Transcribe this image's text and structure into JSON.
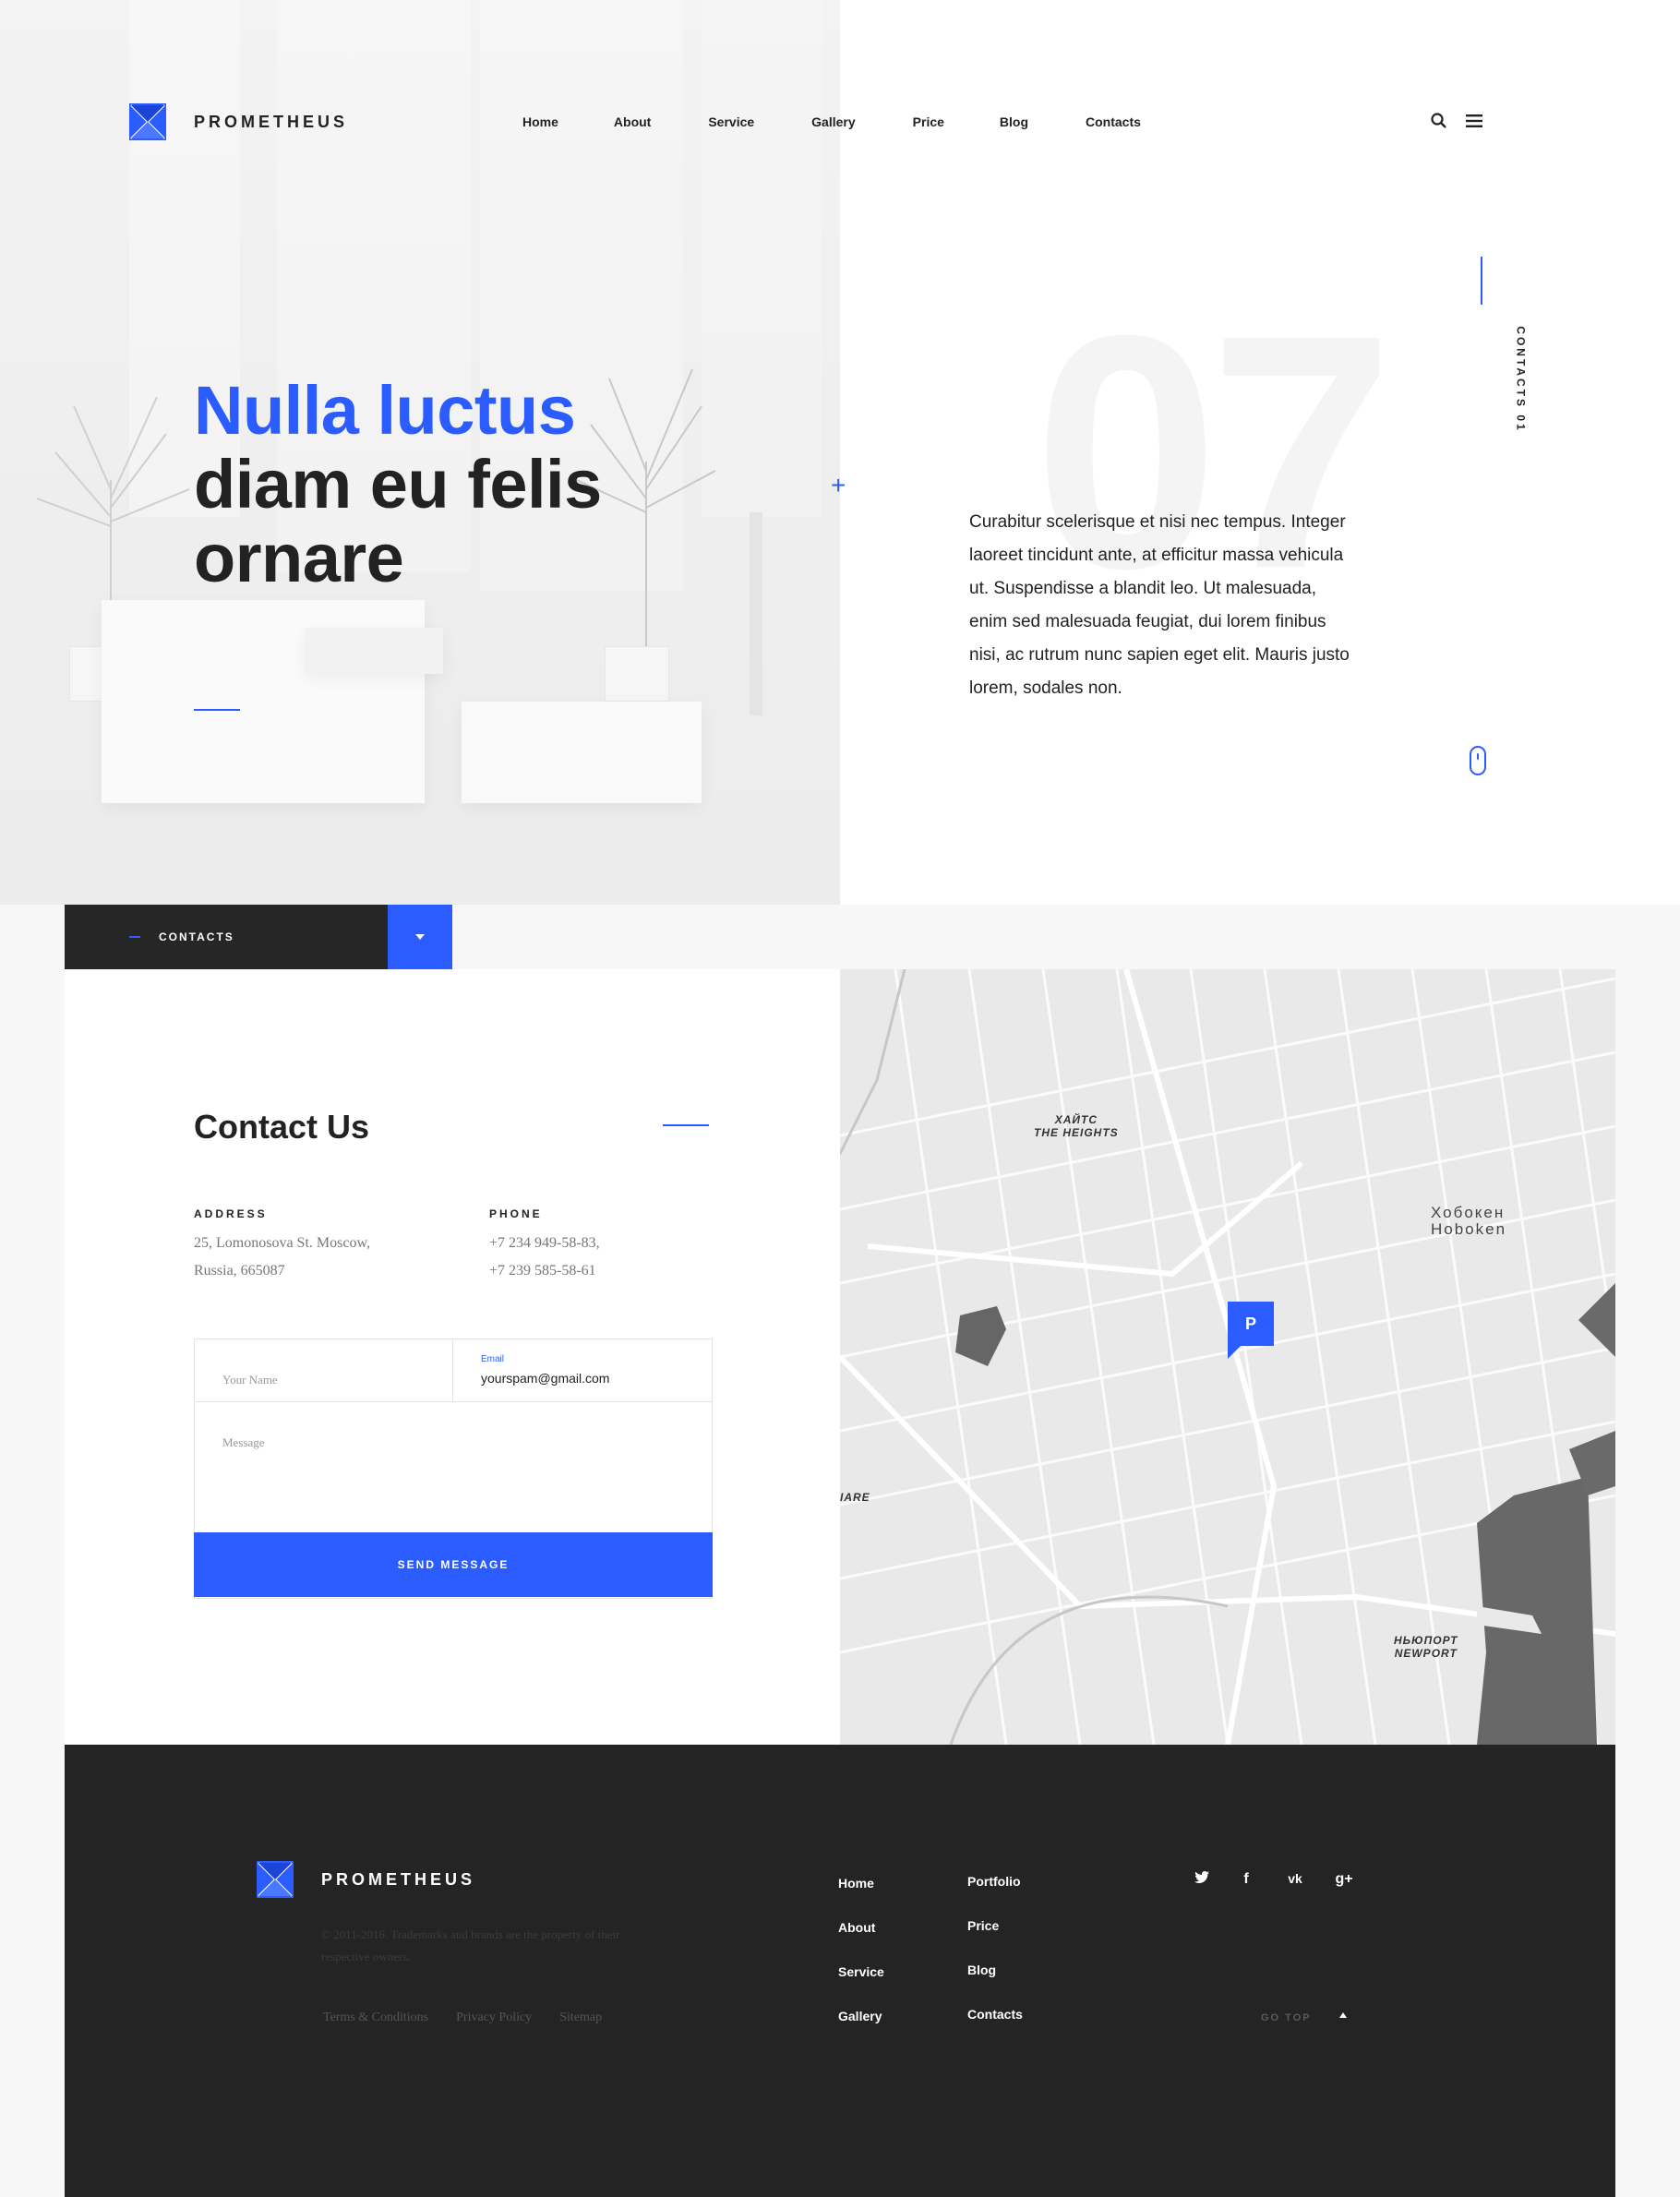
{
  "brand": {
    "name": "PROMETHEUS",
    "accent": "#2b5cff",
    "dark": "#242424"
  },
  "nav": {
    "items": [
      "Home",
      "About",
      "Service",
      "Gallery",
      "Price",
      "Blog",
      "Contacts"
    ]
  },
  "header_icons": [
    "search-icon",
    "menu-icon"
  ],
  "hero": {
    "line1": "Nulla luctus",
    "line2": "diam eu felis",
    "line3": "ornare",
    "big_number": "07",
    "side_label": "CONTACTS 01",
    "text": "Curabitur scelerisque et nisi nec tempus. Integer laoreet tincidunt ante, at efficitur massa vehicula ut. Suspendisse a blandit leo. Ut malesuada, enim sed malesuada feugiat, dui lorem finibus nisi, ac rutrum nunc sapien eget elit. Mauris justo lorem, sodales non."
  },
  "contacts_bar": {
    "label": "CONTACTS"
  },
  "contact": {
    "title": "Contact Us",
    "address_label": "ADDRESS",
    "address_line1": "25, Lomonosova St. Moscow,",
    "address_line2": "Russia, 665087",
    "phone_label": "PHONE",
    "phone1": "+7 234 949-58-83,",
    "phone2": "+7 239 585-58-61",
    "form": {
      "name_placeholder": "Your Name",
      "email_label": "Email",
      "email_value": "yourspam@gmail.com",
      "message_placeholder": "Message",
      "send_label": "SEND MESSAGE"
    }
  },
  "map": {
    "labels": {
      "heights_ru": "ХАЙТС",
      "heights_en": "THE HEIGHTS",
      "hoboken_ru": "Хобокен",
      "hoboken_en": "Hoboken",
      "newport_ru": "НЬЮПОРТ",
      "newport_en": "NEWPORT",
      "edge": "IARE"
    },
    "marker": "P"
  },
  "footer": {
    "brand": "PROMETHEUS",
    "copyright": "© 2011-2016. Trademarks and brands are the property of their respective owners.",
    "links": [
      "Terms & Conditions",
      "Privacy Policy",
      "Sitemap"
    ],
    "nav_col1": [
      "Home",
      "About",
      "Service",
      "Gallery"
    ],
    "nav_col2": [
      "Portfolio",
      "Price",
      "Blog",
      "Contacts"
    ],
    "social": [
      "twitter-icon",
      "facebook-icon",
      "vk-icon",
      "google-plus-icon"
    ],
    "social_glyphs": {
      "facebook": "f",
      "vk": "vk",
      "google_plus": "g+"
    },
    "gotop": "GO TOP"
  }
}
